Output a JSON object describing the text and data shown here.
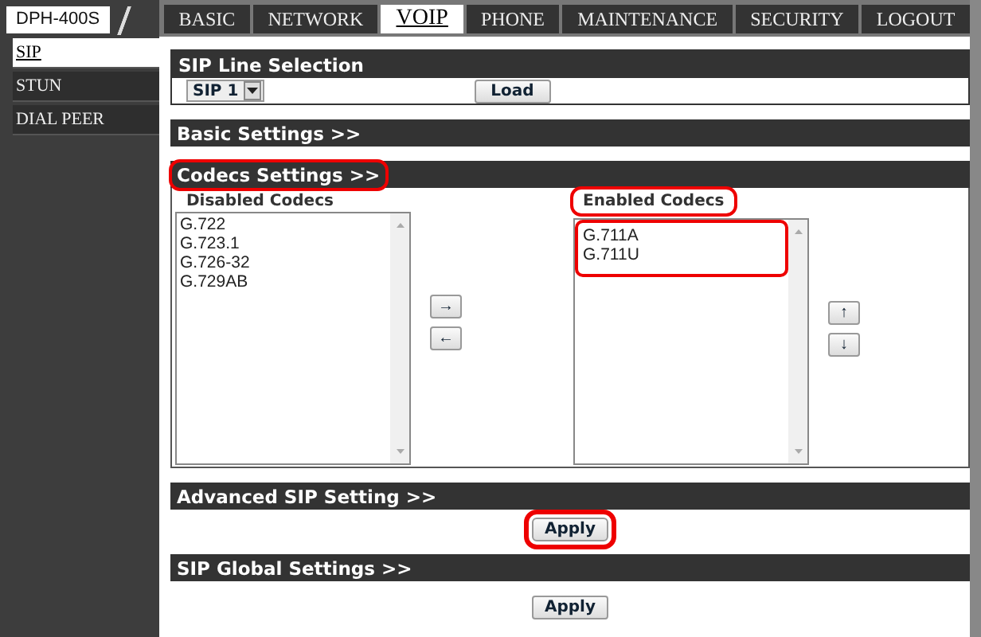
{
  "logo": "DPH-400S",
  "tabs": [
    {
      "label": "BASIC",
      "selected": false
    },
    {
      "label": "NETWORK",
      "selected": false
    },
    {
      "label": "VOIP",
      "selected": true
    },
    {
      "label": "PHONE",
      "selected": false
    },
    {
      "label": "MAINTENANCE",
      "selected": false
    },
    {
      "label": "SECURITY",
      "selected": false
    },
    {
      "label": "LOGOUT",
      "selected": false
    }
  ],
  "sidebar": {
    "items": [
      {
        "label": "SIP",
        "selected": true
      },
      {
        "label": "STUN",
        "selected": false
      },
      {
        "label": "DIAL PEER",
        "selected": false
      }
    ]
  },
  "sip_line_selection": {
    "title": "SIP Line Selection",
    "line": "SIP 1",
    "button": "Load"
  },
  "basic_settings": {
    "title": "Basic Settings >>"
  },
  "codecs_settings": {
    "title": "Codecs Settings >>",
    "highlighted": true,
    "disabled_codecs": {
      "title": "Disabled Codecs",
      "highlighted": false,
      "items": [
        "G.722",
        "G.723.1",
        "G.726-32",
        "G.729AB"
      ]
    },
    "move_buttons": [
      "→",
      "←"
    ],
    "enabled_codecs": {
      "title": "Enabled Codecs",
      "highlighted": true,
      "items": [
        "G.711A",
        "G.711U"
      ]
    },
    "order_buttons": [
      "↑",
      "↓"
    ]
  },
  "advanced_sip_setting": {
    "title": "Advanced SIP Setting >>",
    "button": "Apply",
    "button_highlighted": true
  },
  "sip_global_settings": {
    "title": "SIP Global Settings >>",
    "button": "Apply",
    "button_highlighted": false
  }
}
